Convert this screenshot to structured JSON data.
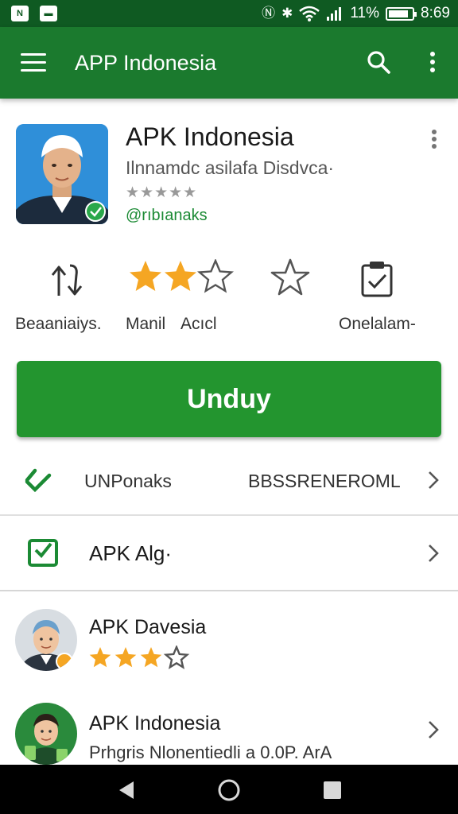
{
  "status_bar": {
    "battery_text": "11%",
    "time": "8:69",
    "battery_level": 0.85,
    "icons": [
      "notification-icon",
      "image-icon",
      "nfc-icon",
      "bluetooth-icon",
      "wifi-icon",
      "signal-icon",
      "battery-icon"
    ]
  },
  "app_bar": {
    "title": "APP Indonesia",
    "icons": [
      "menu-icon",
      "search-icon",
      "more-vert-icon"
    ]
  },
  "app": {
    "name": "APK Indonesia",
    "subtitle": "Ilnnamdc asilafa Disdvca·",
    "stars_text": "★★★★★",
    "developer": "@rıbıanaks",
    "icon": "app-avatar-icon"
  },
  "stats": [
    {
      "label": "Beaaniaiys.",
      "icon": "swap-icon"
    },
    {
      "label": "Manil",
      "icon": "rating-stars-icon",
      "rating": 2
    },
    {
      "label": "Acıcl",
      "icon": "star-outline-icon"
    },
    {
      "label": "Onelalam-",
      "icon": "clipboard-check-icon"
    }
  ],
  "download_label": "Unduy",
  "info_row": {
    "left": "UNPonaks",
    "right": "BBSSRENEROML"
  },
  "apk_row": {
    "label": "APK Alg·"
  },
  "reviews": [
    {
      "name": "APK Davesia",
      "rating": 3,
      "max": 4,
      "avatar": "user-avatar-icon"
    },
    {
      "name": "APK Indonesia",
      "text": "Prhgris Nlonentiedli a 0.0P. ArA",
      "avatar": "user-avatar-green-icon"
    }
  ],
  "colors": {
    "status_bar": "#0f5a22",
    "app_bar": "#1b7a2e",
    "accent": "#23952f",
    "star": "#f5a623"
  },
  "nav": {
    "icons": [
      "back-icon",
      "home-icon",
      "recents-icon"
    ]
  }
}
